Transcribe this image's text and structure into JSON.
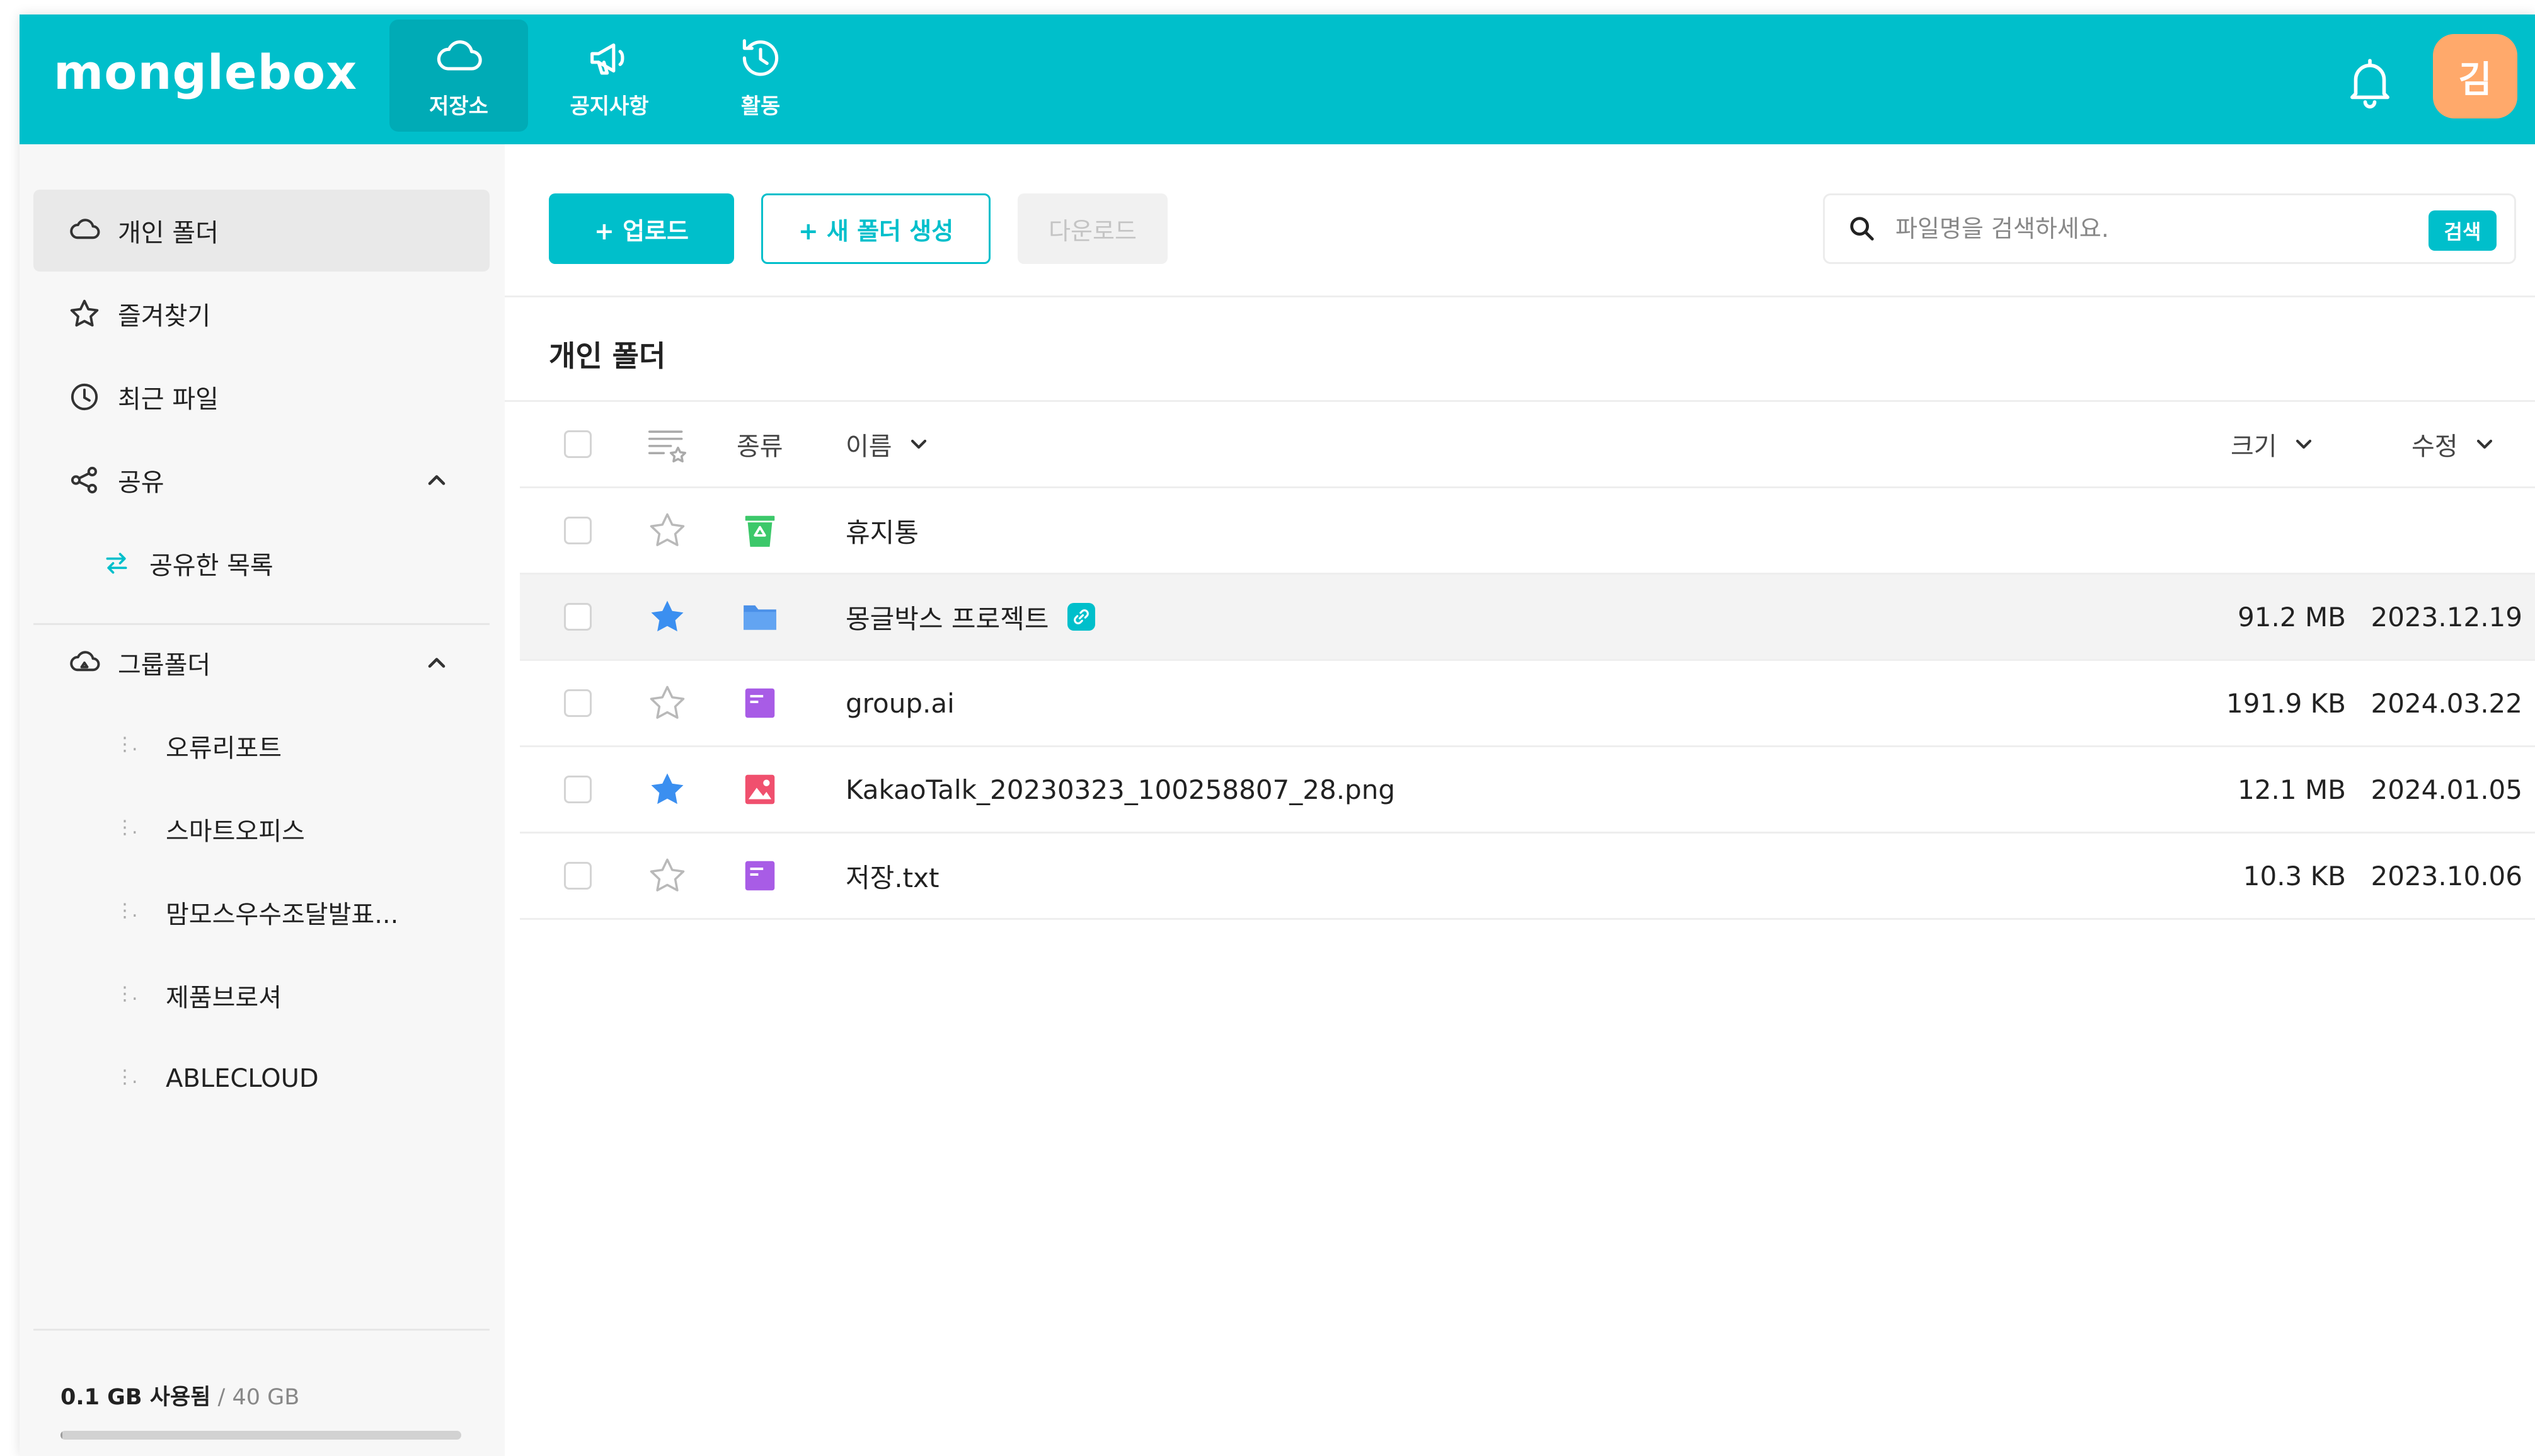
{
  "header": {
    "logo": "monglebox",
    "tabs": [
      {
        "label": "저장소",
        "icon": "cloud-icon",
        "active": true
      },
      {
        "label": "공지사항",
        "icon": "megaphone-icon",
        "active": false
      },
      {
        "label": "활동",
        "icon": "history-icon",
        "active": false
      }
    ],
    "avatar_initial": "김",
    "accent_color": "#00bfcb",
    "avatar_color": "#ffa96b"
  },
  "sidebar": {
    "items": [
      {
        "label": "개인 폴더",
        "icon": "cloud-outline-icon"
      },
      {
        "label": "즐겨찾기",
        "icon": "star-outline-icon"
      },
      {
        "label": "최근 파일",
        "icon": "clock-icon"
      },
      {
        "label": "공유",
        "icon": "share-icon"
      },
      {
        "label": "그룹폴더",
        "icon": "cloud-group-icon"
      }
    ],
    "share_children": [
      {
        "label": "공유한 목록",
        "icon": "swap-arrows-icon"
      }
    ],
    "group_children": [
      {
        "label": "오류리포트"
      },
      {
        "label": "스마트오피스"
      },
      {
        "label": "맘모스우수조달발표..."
      },
      {
        "label": "제품브로셔"
      },
      {
        "label": "ABLECLOUD"
      }
    ],
    "storage": {
      "used": "0.1 GB 사용됨",
      "separator": " / ",
      "total": "40 GB",
      "used_fraction": 0.0025
    }
  },
  "toolbar": {
    "upload_label": "+ 업로드",
    "new_folder_label": "+ 새 폴더 생성",
    "download_label": "다운로드",
    "search_placeholder": "파일명을 검색하세요.",
    "search_button": "검색"
  },
  "main": {
    "title": "개인 폴더",
    "columns": {
      "type": "종류",
      "name": "이름",
      "size": "크기",
      "modified": "수정"
    },
    "rows": [
      {
        "name": "휴지통",
        "type_icon": "trash-icon",
        "starred": false,
        "size": "",
        "date": "",
        "shared": false
      },
      {
        "name": "몽글박스 프로젝트",
        "type_icon": "folder-icon",
        "starred": true,
        "size": "91.2 MB",
        "date": "2023.12.19",
        "shared": true
      },
      {
        "name": "group.ai",
        "type_icon": "document-icon",
        "starred": false,
        "size": "191.9 KB",
        "date": "2024.03.22",
        "shared": false
      },
      {
        "name": "KakaoTalk_20230323_100258807_28.png",
        "type_icon": "image-icon",
        "starred": true,
        "size": "12.1 MB",
        "date": "2024.01.05",
        "shared": false
      },
      {
        "name": "저장.txt",
        "type_icon": "document-icon",
        "starred": false,
        "size": "10.3 KB",
        "date": "2023.10.06",
        "shared": false
      }
    ]
  }
}
